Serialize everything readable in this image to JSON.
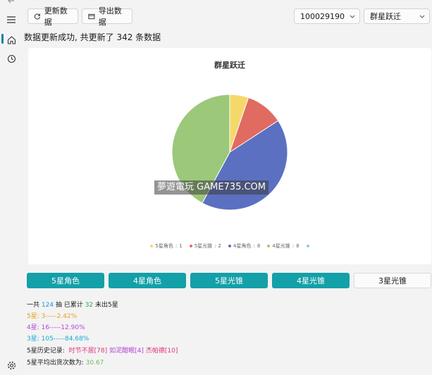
{
  "toolbar": {
    "update_label": "更新数据",
    "export_label": "导出数据",
    "account_value": "100029190",
    "pool_value": "群星跃迁"
  },
  "status_text": "数据更新成功, 共更新了 342 条数据",
  "watermark": "夢遊電玩 GAME735.COM",
  "chart_data": {
    "type": "pie",
    "title": "群星跃迁",
    "slices": [
      {
        "label": "5星角色",
        "value": 1,
        "color": "#f5d86a"
      },
      {
        "label": "5星光锥",
        "value": 2,
        "color": "#e06b60"
      },
      {
        "label": "4星角色",
        "value": 8,
        "color": "#5b70c0"
      },
      {
        "label": "4星光锥",
        "value": 8,
        "color": "#9cc87a"
      }
    ],
    "legend_placement": "bottom"
  },
  "tabs": [
    {
      "label": "5星角色"
    },
    {
      "label": "4星角色"
    },
    {
      "label": "5星光锥"
    },
    {
      "label": "4星光锥"
    },
    {
      "label": "3星光锥"
    }
  ],
  "stats": {
    "total_prefix": "一共",
    "total_pulls": "124",
    "total_mid": "抽 已累计",
    "since_five": "32",
    "total_suffix": "未出5星",
    "five_star_line": "5星: 3-----2.42%",
    "four_star_line": "4星: 16-----12.90%",
    "three_star_line": "3星: 105-----84.68%",
    "history_label": "5星历史记录:",
    "history_entries": [
      "时节不居[78]",
      "如泥酣眠[4]",
      "杰帕德[10]"
    ],
    "avg_label": "5星平均出货次数为:",
    "avg_value": "30.67"
  },
  "colors": {
    "accent_teal": "#13a0a8",
    "page_bg": "#f3f3f3"
  },
  "icons": {
    "update": "refresh-icon",
    "export": "export-icon",
    "home": "home-icon",
    "history": "history-icon",
    "settings": "gear-icon",
    "menu": "hamburger-icon",
    "back": "back-arrow-icon"
  }
}
